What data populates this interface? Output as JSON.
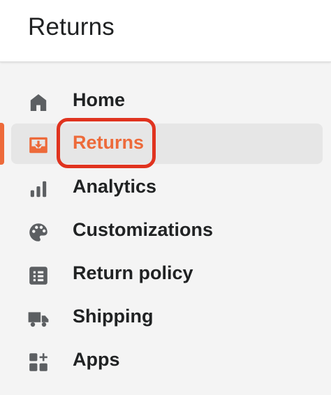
{
  "header": {
    "title": "Returns"
  },
  "accent_color": "#ed6a3a",
  "nav": {
    "active_item": "Returns",
    "items": [
      {
        "label": "Home",
        "icon": "home-icon"
      },
      {
        "label": "Returns",
        "icon": "return-tray-icon"
      },
      {
        "label": "Analytics",
        "icon": "bar-chart-icon"
      },
      {
        "label": "Customizations",
        "icon": "palette-icon"
      },
      {
        "label": "Return policy",
        "icon": "list-icon"
      },
      {
        "label": "Shipping",
        "icon": "truck-icon"
      },
      {
        "label": "Apps",
        "icon": "apps-plus-icon"
      }
    ]
  }
}
